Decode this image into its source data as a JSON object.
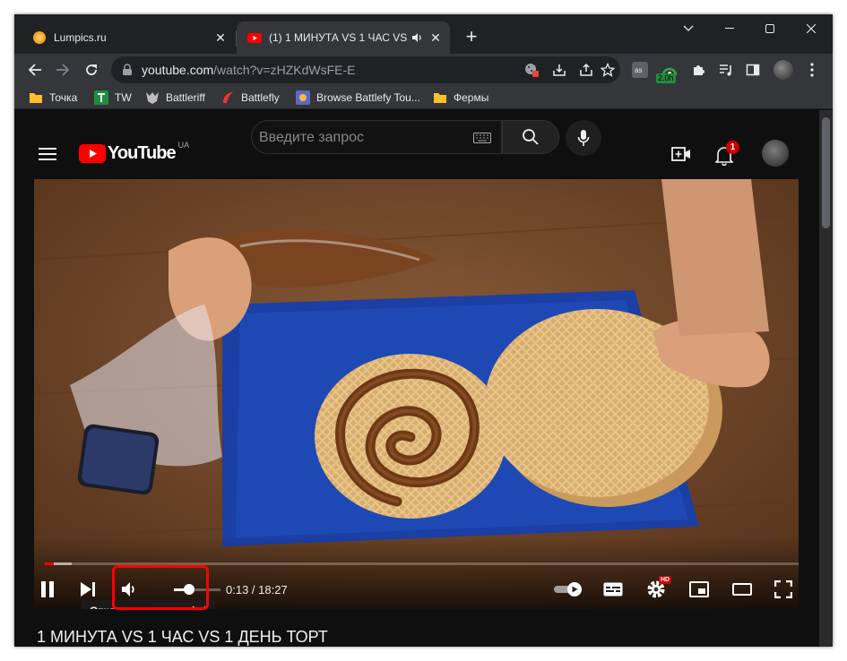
{
  "tabs": [
    {
      "title": "Lumpics.ru",
      "active": false
    },
    {
      "title": "(1) 1 МИНУТА VS 1 ЧАС VS",
      "active": true
    }
  ],
  "address": {
    "host": "youtube.com",
    "path": "/watch?v=zHZKdWsFE-E"
  },
  "extensions": {
    "badge_text": "2.0h"
  },
  "bookmarks": [
    {
      "label": "Точка",
      "icon": "folder-icon"
    },
    {
      "label": "TW",
      "icon": "tw-icon"
    },
    {
      "label": "Battleriff",
      "icon": "battleriff-icon"
    },
    {
      "label": "Battlefly",
      "icon": "battlefly-icon"
    },
    {
      "label": "Browse Battlefy Tou...",
      "icon": "battlefy-icon"
    },
    {
      "label": "Фермы",
      "icon": "folder-icon"
    }
  ],
  "youtube": {
    "logo_text": "YouTube",
    "region": "UA",
    "search_placeholder": "Введите запрос",
    "notification_count": "1"
  },
  "player": {
    "tooltip": "Отключение звука (m)",
    "time": "0:13 / 18:27",
    "progress_fraction": 0.012,
    "buffered_fraction": 0.035,
    "volume_fraction": 0.32,
    "quality_badge": "HD"
  },
  "video": {
    "title": "1 МИНУТА VS 1 ЧАС VS 1 ДЕНЬ ТОРТ"
  },
  "colors": {
    "accent": "#ff0000",
    "frame": "#202124",
    "toolbar": "#35363a",
    "page_bg": "#0f0f0f"
  }
}
